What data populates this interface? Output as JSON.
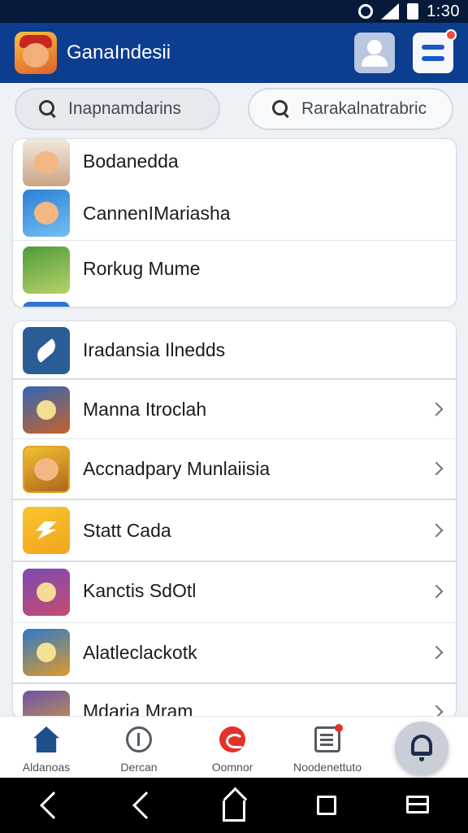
{
  "status_bar": {
    "time": "1:30"
  },
  "app_bar": {
    "title": "GanaIndesii"
  },
  "search": {
    "left_placeholder": "Inapnamdarins",
    "right_placeholder": "Rarakalnatrabric"
  },
  "featured_list": [
    {
      "label": "Bodanedda",
      "icon": "character-face-icon"
    },
    {
      "label": "CannenIMariasha",
      "icon": "character-cap-icon"
    },
    {
      "label": "Rorkug Mume",
      "icon": "forest-scene-icon"
    }
  ],
  "main_list": [
    {
      "label": "Iradansia Ilnedds",
      "icon": "feather-icon",
      "chevron": false
    },
    {
      "label": "Manna Itroclah",
      "icon": "warrior-icon",
      "chevron": true
    },
    {
      "label": "Accnadpary Munlaiisia",
      "icon": "treasure-character-icon",
      "chevron": true
    },
    {
      "label": "Statt Cada",
      "icon": "lightning-bolt-icon",
      "chevron": true
    },
    {
      "label": "Kanctis SdOtl",
      "icon": "castle-battle-icon",
      "chevron": true
    },
    {
      "label": "Alatleclackotk",
      "icon": "sunburst-icon",
      "chevron": true
    },
    {
      "label": "Mdaria Mram",
      "icon": "arcade-icon",
      "chevron": true
    }
  ],
  "bottom_nav": [
    {
      "label": "Aldanoas",
      "icon": "home-icon"
    },
    {
      "label": "Dercan",
      "icon": "shield-icon"
    },
    {
      "label": "Oomnor",
      "icon": "red-circle-icon"
    },
    {
      "label": "Noodenettuto",
      "icon": "news-icon"
    }
  ],
  "colors": {
    "app_bar": "#0c3d8f",
    "status_bar": "#071a3a",
    "notification": "#ef4e3f"
  }
}
